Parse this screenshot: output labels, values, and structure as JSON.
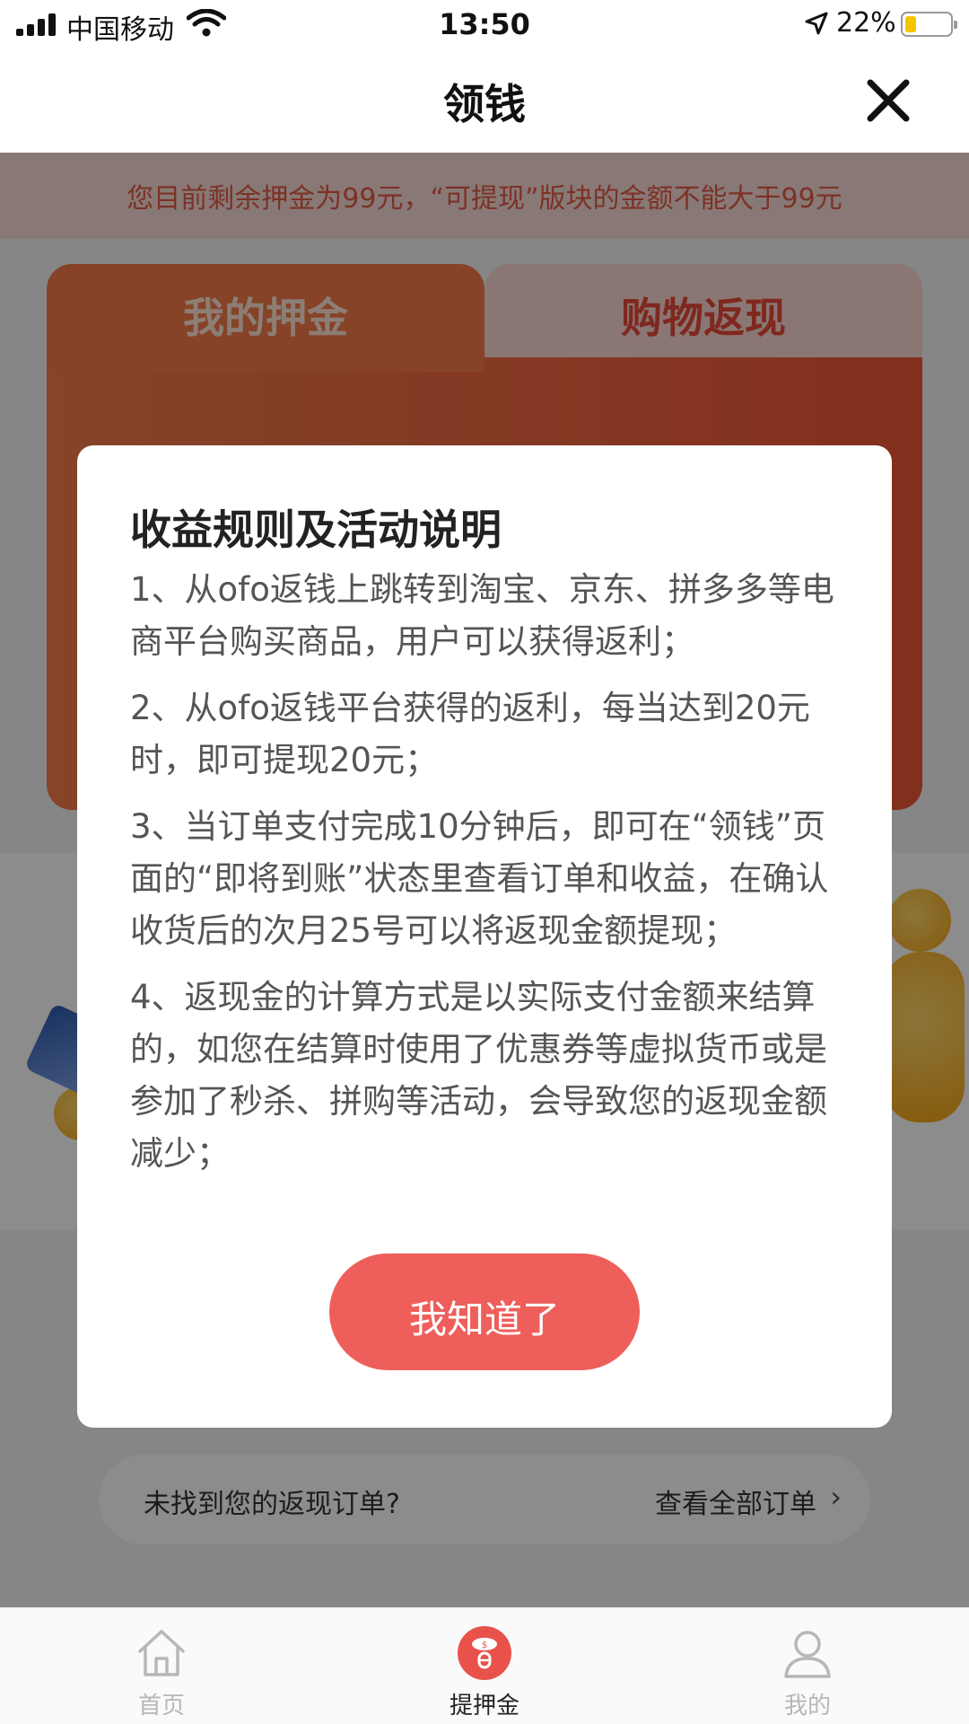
{
  "status_bar": {
    "carrier": "中国移动",
    "time": "13:50",
    "battery": "22%",
    "battery_level": 0.22
  },
  "navbar": {
    "title": "领钱",
    "close_icon": "close-icon"
  },
  "notice": {
    "text": "您目前剩余押金为99元，“可提现”版块的金额不能大于99元"
  },
  "tabs": {
    "deposit": "我的押金",
    "cashback": "购物返现"
  },
  "orders_strip": {
    "missing_orders": "未找到您的返现订单?",
    "view_all": "查看全部订单"
  },
  "modal": {
    "title": "收益规则及活动说明",
    "rules": [
      "1、从ofo返钱上跳转到淘宝、京东、拼多多等电商平台购买商品，用户可以获得返利；",
      "2、从ofo返钱平台获得的返利，每当达到20元时，即可提现20元；",
      "3、当订单支付完成10分钟后，即可在“领钱”页面的“即将到账”状态里查看订单和收益，在确认收货后的次月25号可以将返现金额提现；",
      "4、返现金的计算方式是以实际支付金额来结算的，如您在结算时使用了优惠券等虚拟货币或是参加了秒杀、拼购等活动，会导致您的返现金额减少；"
    ],
    "confirm": "我知道了"
  },
  "tabbar": {
    "home": "首页",
    "deposit": "提押金",
    "mine": "我的"
  }
}
